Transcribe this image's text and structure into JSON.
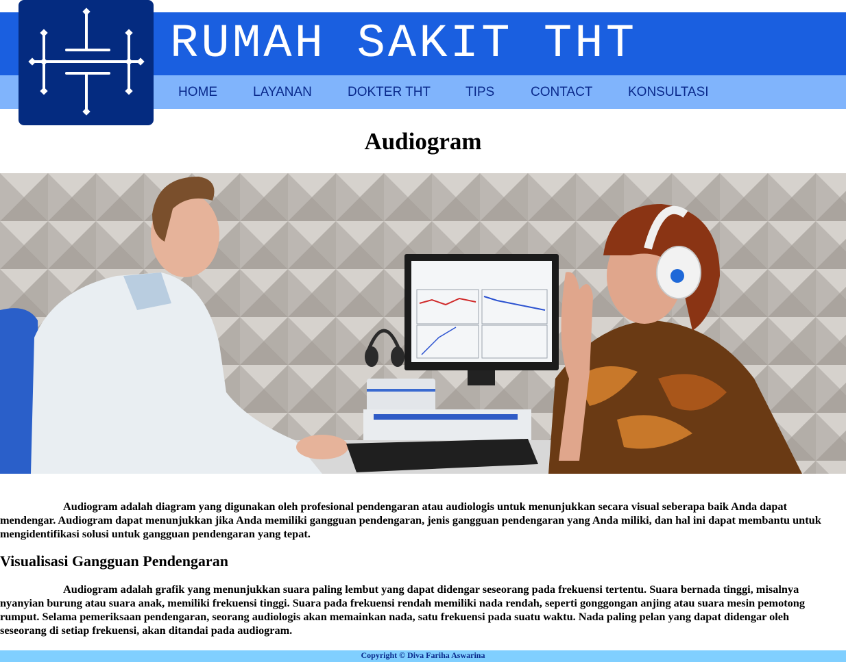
{
  "header": {
    "site_title": "RUMAH SAKIT THT",
    "logo_icon": "hospital-emblem-icon",
    "colors": {
      "top_band": "#1a5fe0",
      "nav_band": "#80b4fc",
      "logo_bg": "#042b80",
      "nav_text": "#0a2a8c"
    }
  },
  "nav": {
    "items": [
      {
        "label": "HOME"
      },
      {
        "label": "LAYANAN"
      },
      {
        "label": "DOKTER THT"
      },
      {
        "label": "TIPS"
      },
      {
        "label": "CONTACT"
      },
      {
        "label": "KONSULTASI"
      }
    ]
  },
  "main": {
    "title": "Audiogram",
    "hero_image": "photo-audiologist-hearing-test",
    "paragraph_1": "Audiogram adalah diagram yang digunakan oleh profesional pendengaran atau audiologis untuk menunjukkan secara visual seberapa baik Anda dapat mendengar. Audiogram dapat menunjukkan jika Anda memiliki gangguan pendengaran, jenis gangguan pendengaran yang Anda miliki, dan hal ini dapat membantu untuk mengidentifikasi solusi untuk gangguan pendengaran yang tepat.",
    "subheading": "Visualisasi Gangguan Pendengaran",
    "paragraph_2": "Audiogram adalah grafik yang menunjukkan suara paling lembut yang dapat didengar seseorang pada frekuensi tertentu. Suara bernada tinggi, misalnya nyanyian burung atau suara anak, memiliki frekuensi tinggi. Suara pada frekuensi rendah memiliki nada rendah, seperti gonggongan anjing atau suara mesin pemotong rumput. Selama pemeriksaan pendengaran, seorang audiologis akan memainkan nada, satu frekuensi pada suatu waktu. Nada paling pelan yang dapat didengar oleh seseorang di setiap frekuensi, akan ditandai pada audiogram."
  },
  "footer": {
    "copyright": "Copyright © Diva Fariha Aswarina",
    "color": "#80cfff"
  }
}
